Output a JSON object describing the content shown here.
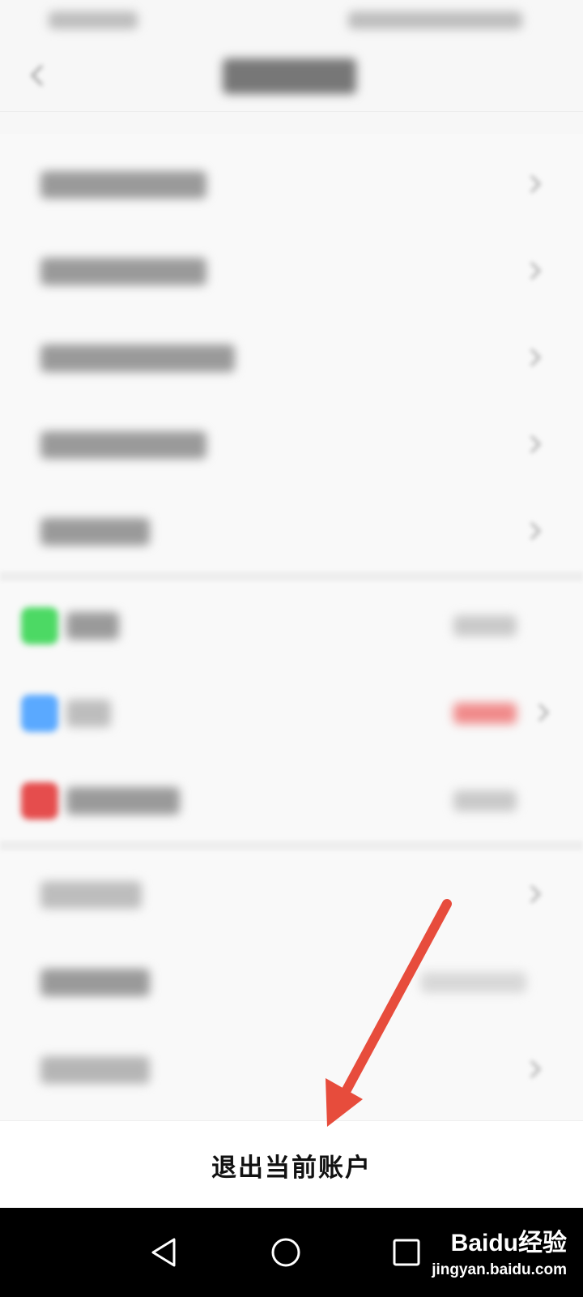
{
  "logout": {
    "label": "退出当前账户"
  },
  "watermark": {
    "brand": "Baidu经验",
    "url": "jingyan.baidu.com"
  },
  "colors": {
    "wechat": "#4cd964",
    "qq": "#5aa9ff",
    "weibo": "#e54d4d",
    "arrow": "#e74c3c",
    "nav_bg": "#000000"
  }
}
